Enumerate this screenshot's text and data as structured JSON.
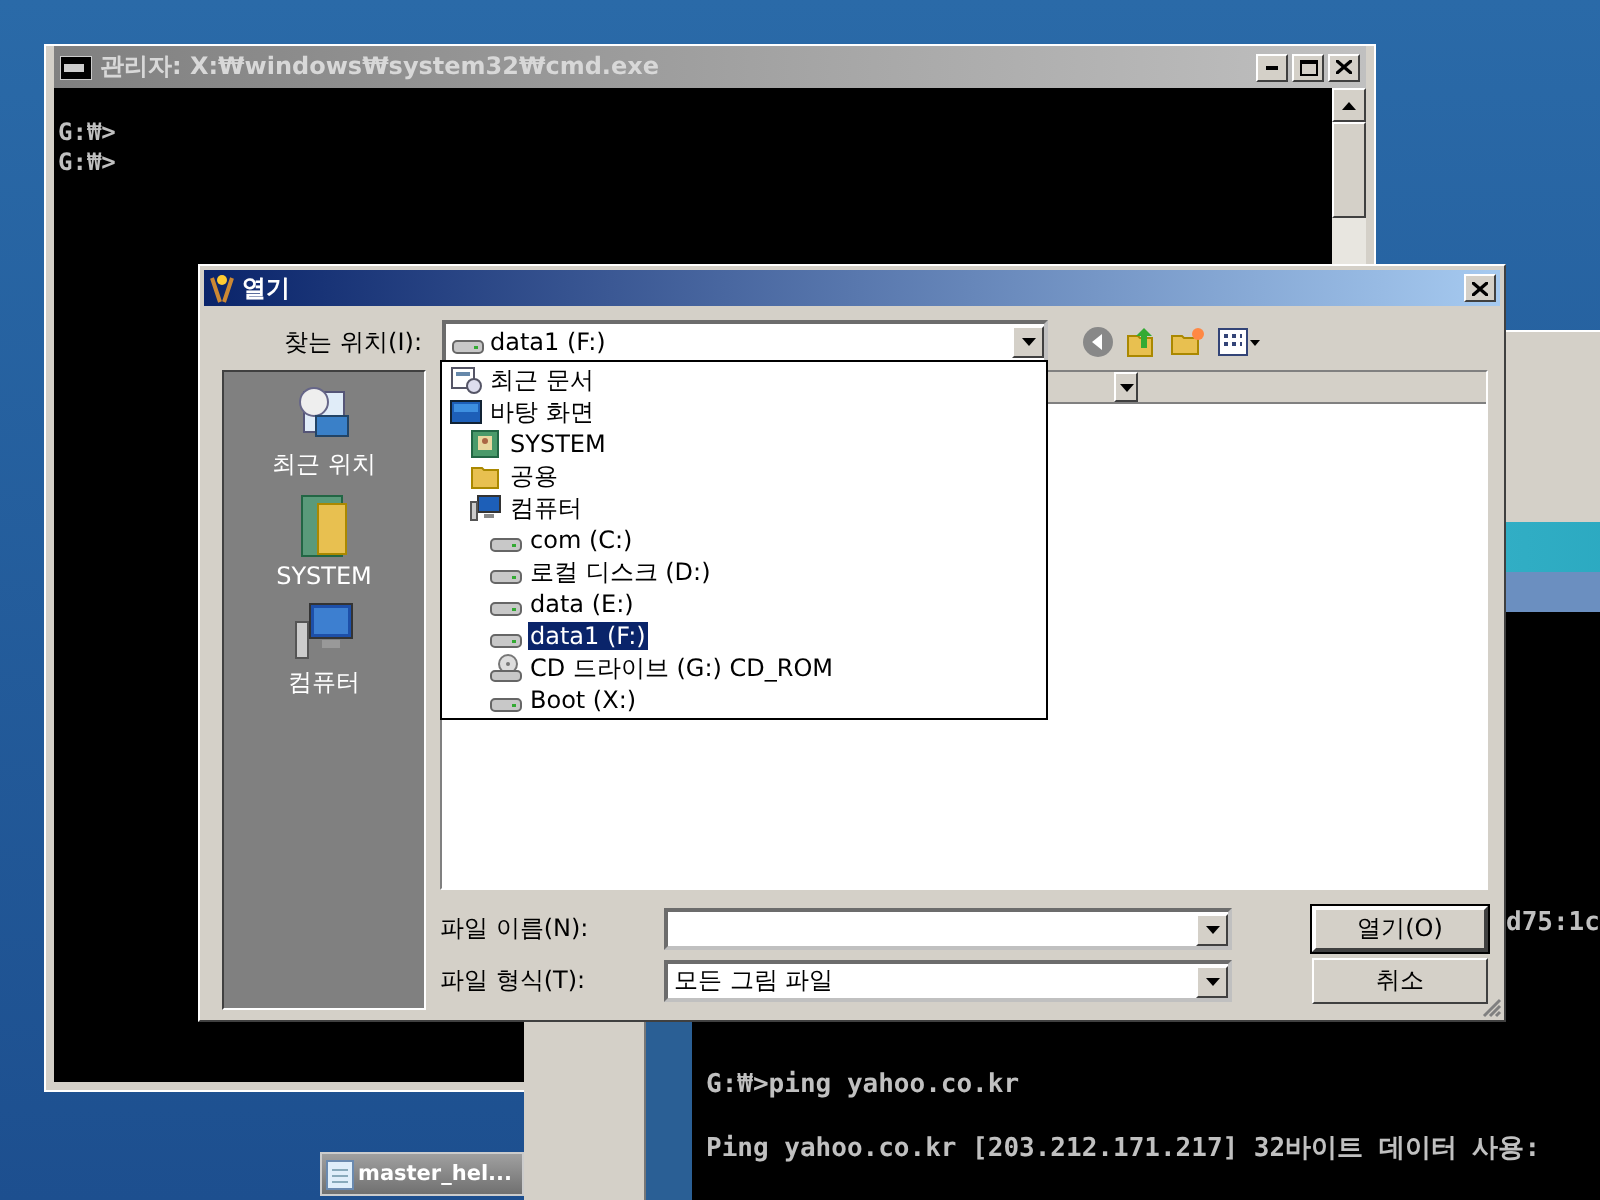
{
  "cmd_window": {
    "title": "관리자: X:₩windows₩system32₩cmd.exe",
    "lines": [
      "G:₩>",
      "G:₩>"
    ]
  },
  "back_console": {
    "fragment": "d75:1c",
    "lines": [
      "G:₩>ping yahoo.co.kr",
      "Ping yahoo.co.kr [203.212.171.217] 32바이트 데이터 사용:"
    ]
  },
  "taskbar_button": {
    "label": "master_hel..."
  },
  "dialog": {
    "title": "열기",
    "look_in": {
      "label": "찾는 위치(I):",
      "value": "data1 (F:)"
    },
    "places": [
      {
        "label": "최근 위치",
        "kind": "recent"
      },
      {
        "label": "SYSTEM",
        "kind": "user"
      },
      {
        "label": "컴퓨터",
        "kind": "computer"
      }
    ],
    "look_in_list": [
      {
        "label": "최근 문서",
        "kind": "recent",
        "selected": false
      },
      {
        "label": "바탕 화면",
        "kind": "desktop",
        "selected": false,
        "children": [
          {
            "label": "SYSTEM",
            "kind": "user",
            "selected": false
          },
          {
            "label": "공용",
            "kind": "folder",
            "selected": false
          },
          {
            "label": "컴퓨터",
            "kind": "computer",
            "selected": false,
            "children": [
              {
                "label": "com (C:)",
                "kind": "drive",
                "selected": false
              },
              {
                "label": "로컬 디스크 (D:)",
                "kind": "drive",
                "selected": false
              },
              {
                "label": "data (E:)",
                "kind": "drive",
                "selected": false
              },
              {
                "label": "data1 (F:)",
                "kind": "drive",
                "selected": true
              },
              {
                "label": "CD 드라이브 (G:) CD_ROM",
                "kind": "cdrom",
                "selected": false
              },
              {
                "label": "Boot (X:)",
                "kind": "drive",
                "selected": false
              }
            ]
          }
        ]
      }
    ],
    "file_name": {
      "label": "파일 이름(N):"
    },
    "file_type": {
      "label": "파일 형식(T):",
      "value": "모든 그림 파일"
    },
    "buttons": [
      {
        "label": "열기(O)",
        "default": true
      },
      {
        "label": "취소",
        "default": false
      }
    ]
  }
}
